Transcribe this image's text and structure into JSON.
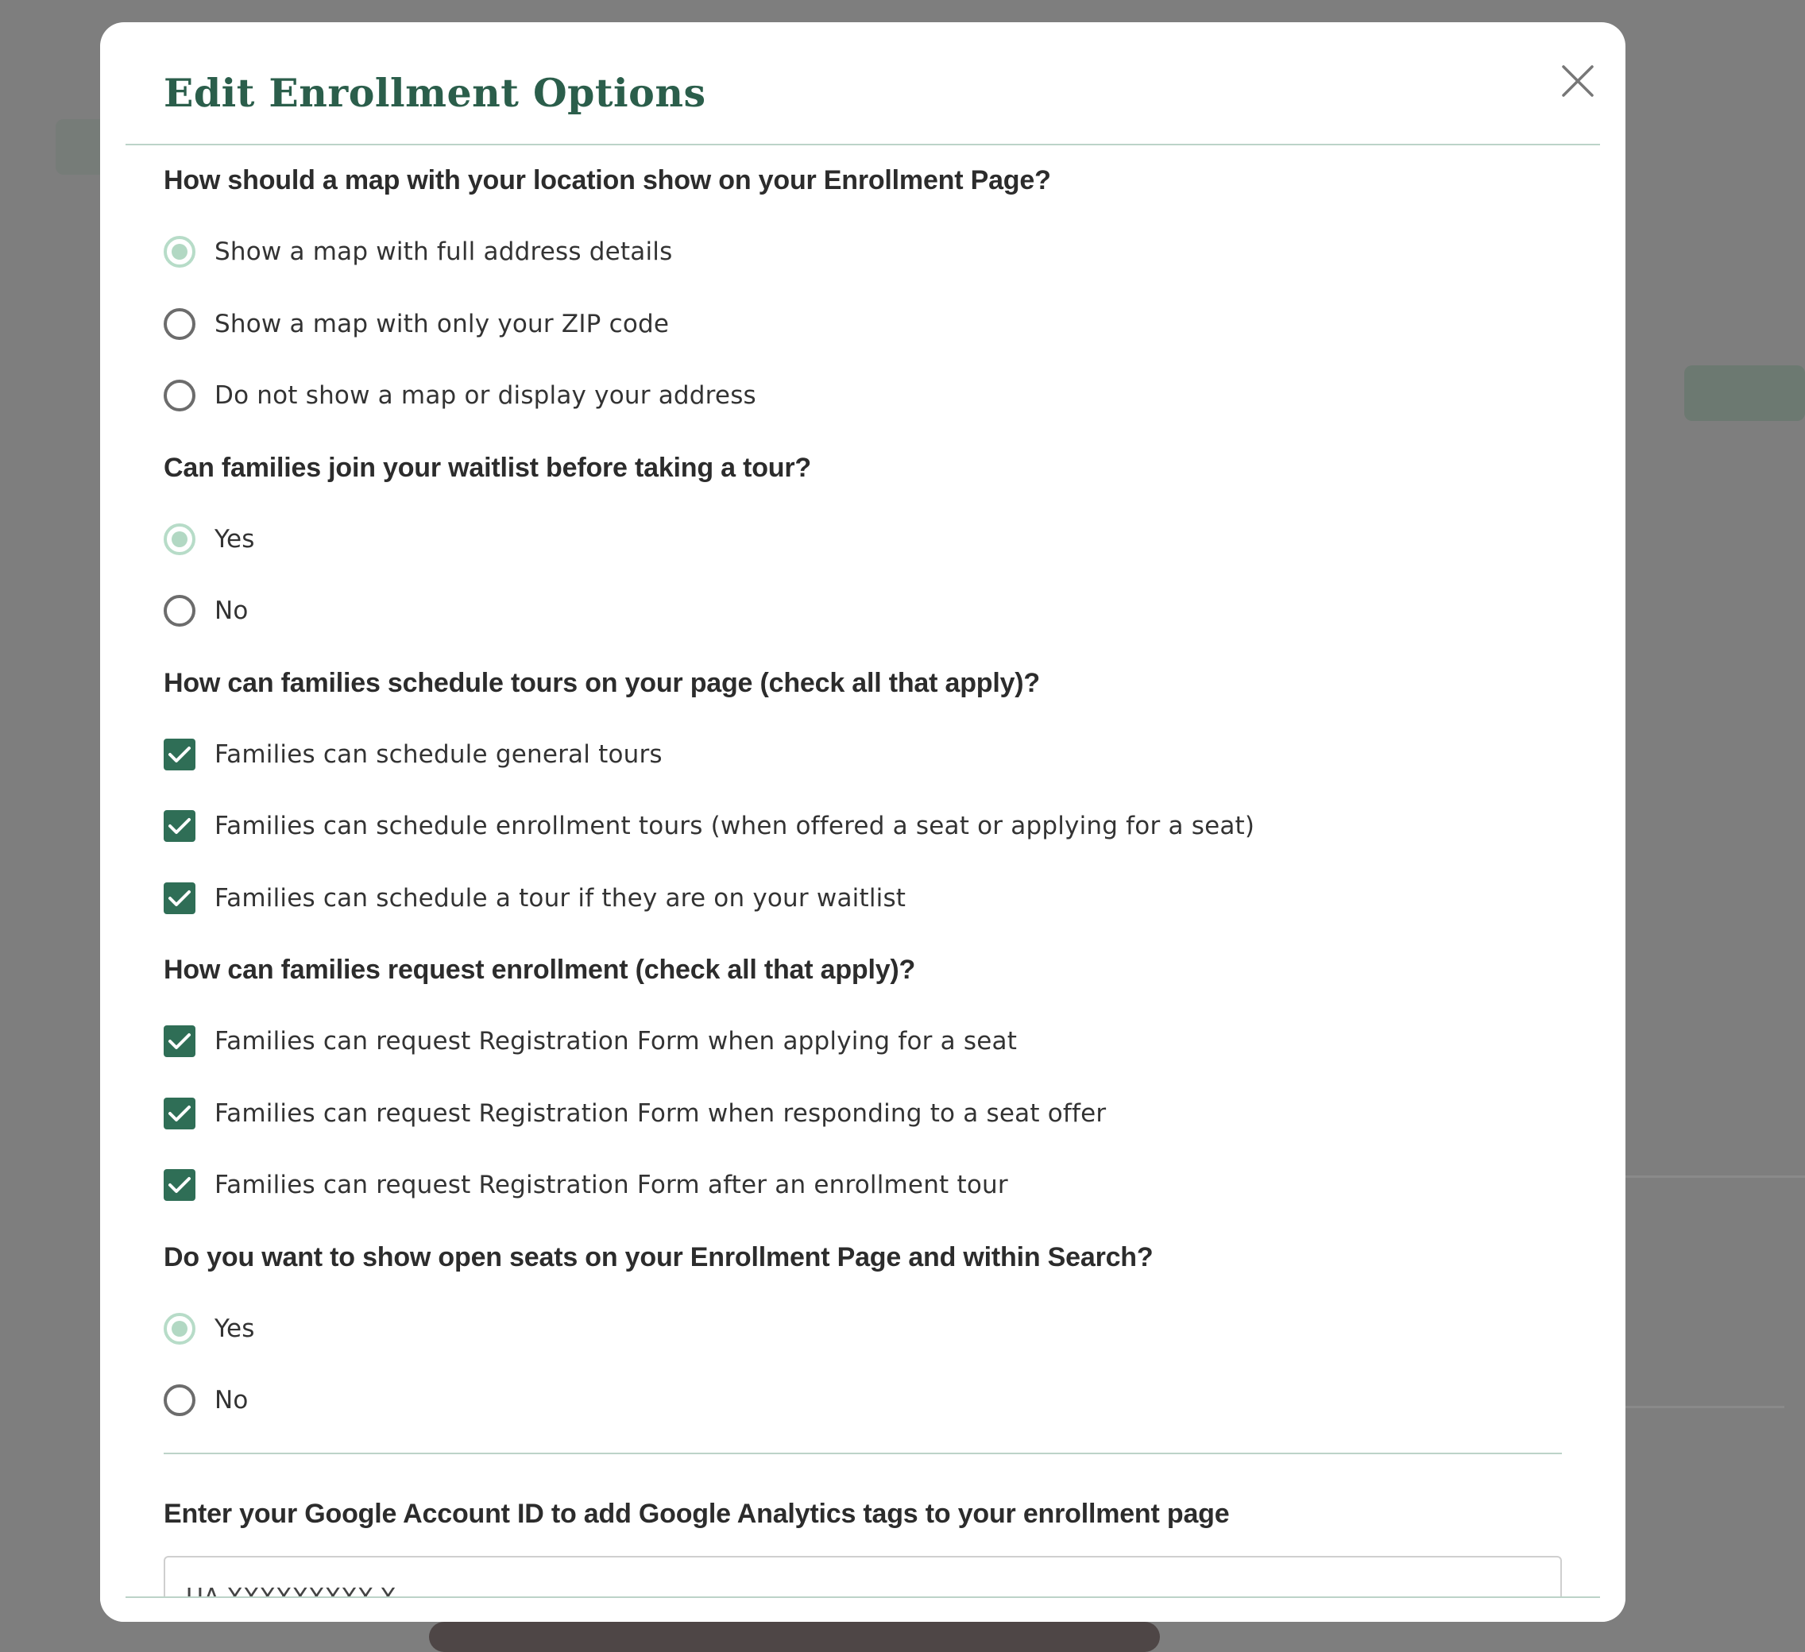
{
  "modal": {
    "title": "Edit Enrollment Options",
    "close_icon": "close-icon"
  },
  "map_question": {
    "label": "How should a map with your location show on your Enrollment Page?",
    "options": [
      {
        "label": "Show a map with full address details",
        "checked": true
      },
      {
        "label": "Show a map with only your ZIP code",
        "checked": false
      },
      {
        "label": "Do not show a map or display your address",
        "checked": false
      }
    ]
  },
  "waitlist_question": {
    "label": "Can families join your waitlist before taking a tour?",
    "options": [
      {
        "label": "Yes",
        "checked": true
      },
      {
        "label": "No",
        "checked": false
      }
    ]
  },
  "tours_question": {
    "label": "How can families schedule tours on your page (check all that apply)?",
    "options": [
      {
        "label": "Families can schedule general tours",
        "checked": true
      },
      {
        "label": "Families can schedule enrollment tours (when offered a seat or applying for a seat)",
        "checked": true
      },
      {
        "label": "Families can schedule a tour if they are on your waitlist",
        "checked": true
      }
    ]
  },
  "enrollment_question": {
    "label": "How can families request enrollment (check all that apply)?",
    "options": [
      {
        "label": "Families can request Registration Form when applying for a seat",
        "checked": true
      },
      {
        "label": "Families can request Registration Form when responding to a seat offer",
        "checked": true
      },
      {
        "label": "Families can request Registration Form after an enrollment tour",
        "checked": true
      }
    ]
  },
  "seats_question": {
    "label": "Do you want to show open seats on your Enrollment Page and within Search?",
    "options": [
      {
        "label": "Yes",
        "checked": true
      },
      {
        "label": "No",
        "checked": false
      }
    ]
  },
  "analytics": {
    "label": "Enter your Google Account ID to add Google Analytics tags to your enrollment page",
    "placeholder": "UA-XXXXXXXXX-X"
  },
  "colors": {
    "accent": "#2b5e4b",
    "checkbox": "#2f6e56",
    "radio_selected": "#b2d8c3",
    "divider": "#bcd3c8",
    "overlay": "#7e7e7e"
  }
}
